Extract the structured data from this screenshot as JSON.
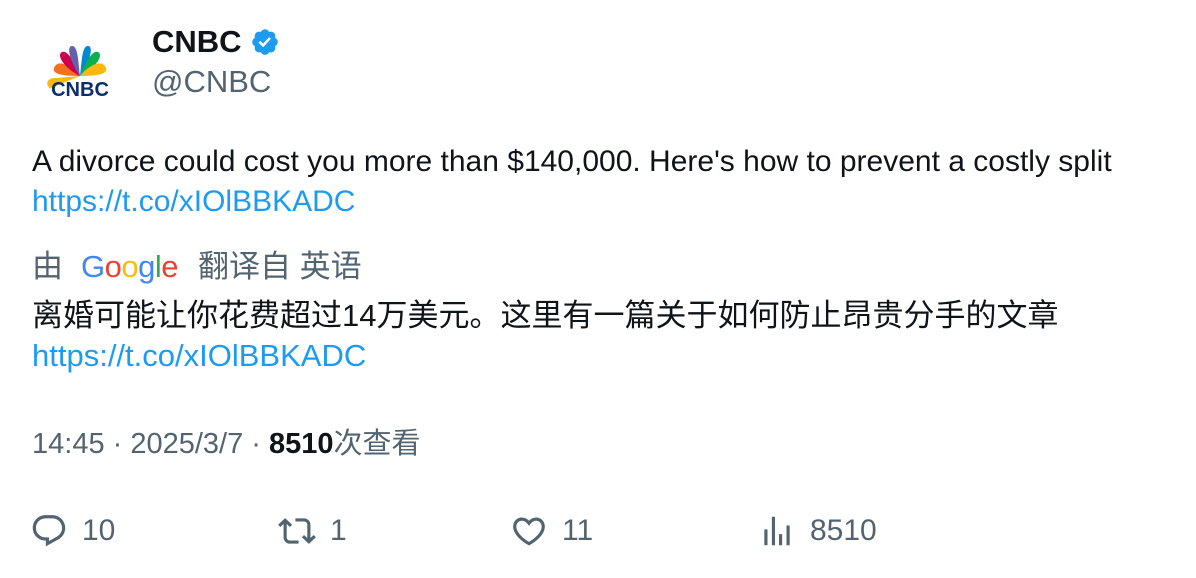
{
  "author": {
    "name": "CNBC",
    "handle": "@CNBC",
    "avatar_text": "CNBC",
    "verified_icon": "verified-badge-icon"
  },
  "tweet": {
    "text": "A divorce could cost you more than $140,000. Here's how to prevent a costly split ",
    "link": "https://t.co/xIOlBBKADC"
  },
  "translation": {
    "prefix": "由",
    "provider": "Google",
    "suffix": "翻译自 英语",
    "text": "离婚可能让你花费超过14万美元。这里有一篇关于如何防止昂贵分手的文章",
    "link": "https://t.co/xIOlBBKADC"
  },
  "meta": {
    "time": "14:45",
    "sep1": " · ",
    "date": "2025/3/7",
    "sep2": " · ",
    "views": "8510",
    "views_label": "次查看"
  },
  "actions": {
    "replies": "10",
    "retweets": "1",
    "likes": "11",
    "views": "8510"
  },
  "colors": {
    "link": "#1d9bf0",
    "secondary_text": "#536471",
    "primary_text": "#0f1419",
    "verified": "#1d9bf0"
  }
}
